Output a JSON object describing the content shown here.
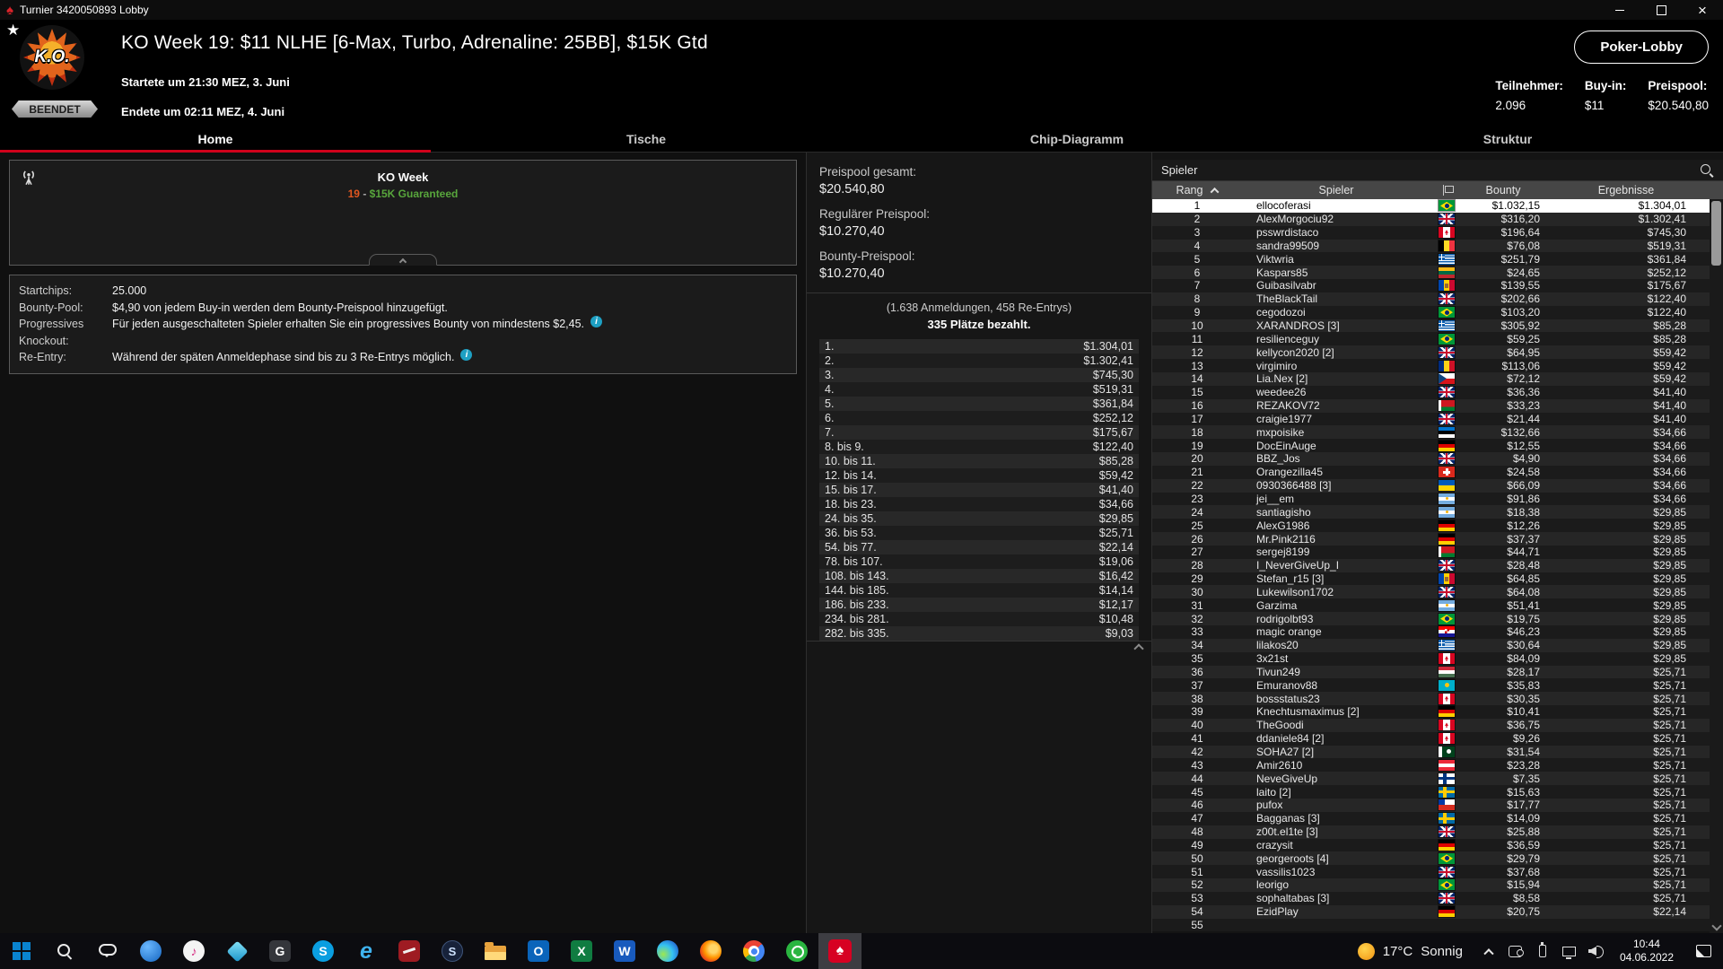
{
  "colors": {
    "accent": "#d0021b",
    "green": "#58a63c",
    "orange": "#e0561f",
    "info": "#1ea0c3",
    "selected_row": "#ffffff"
  },
  "window": {
    "title": "Turnier 3420050893 Lobby"
  },
  "header": {
    "badge": "BEENDET",
    "logo_text": "K.O.",
    "title": "KO Week 19: $11 NLHE [6-Max, Turbo, Adrenaline: 25BB], $15K Gtd",
    "started": "Startete um 21:30 MEZ, 3. Juni",
    "ended": "Endete um 02:11 MEZ, 4. Juni",
    "lobby_button": "Poker-Lobby",
    "stats": [
      {
        "label": "Teilnehmer:",
        "value": "2.096"
      },
      {
        "label": "Buy-in:",
        "value": "$11"
      },
      {
        "label": "Preispool:",
        "value": "$20.540,80"
      }
    ]
  },
  "tabs": [
    {
      "label": "Home",
      "active": true
    },
    {
      "label": "Tische",
      "active": false
    },
    {
      "label": "Chip-Diagramm",
      "active": false
    },
    {
      "label": "Struktur",
      "active": false
    }
  ],
  "broadcast": {
    "title": "KO Week",
    "num": "19",
    "sep": " - ",
    "guarantee": "$15K Guaranteed"
  },
  "details": {
    "rows": [
      {
        "label": "Startchips:",
        "text": "25.000",
        "info": false
      },
      {
        "label": "Bounty-Pool:",
        "text": "$4,90 von jedem Buy-in werden dem Bounty-Preispool hinzugefügt.",
        "info": false
      },
      {
        "label": "Progressives Knockout:",
        "text": "Für jeden ausgeschalteten Spieler erhalten Sie ein progressives Bounty von mindestens $2,45.",
        "info": true
      },
      {
        "label": "Re-Entry:",
        "text": "Während der späten Anmeldephase sind bis zu 3 Re-Entrys möglich.",
        "info": true
      }
    ]
  },
  "prizepool": {
    "total_label": "Preispool gesamt:",
    "total_value": "$20.540,80",
    "regular_label": "Regulärer Preispool:",
    "regular_value": "$10.270,40",
    "bounty_label": "Bounty-Preispool:",
    "bounty_value": "$10.270,40",
    "entries_line": "(1.638 Anmeldungen, 458 Re-Entrys)",
    "paid_line": "335 Plätze bezahlt."
  },
  "payouts": [
    {
      "place": "1.",
      "amount": "$1.304,01"
    },
    {
      "place": "2.",
      "amount": "$1.302,41"
    },
    {
      "place": "3.",
      "amount": "$745,30"
    },
    {
      "place": "4.",
      "amount": "$519,31"
    },
    {
      "place": "5.",
      "amount": "$361,84"
    },
    {
      "place": "6.",
      "amount": "$252,12"
    },
    {
      "place": "7.",
      "amount": "$175,67"
    },
    {
      "place": "8. bis 9.",
      "amount": "$122,40"
    },
    {
      "place": "10. bis 11.",
      "amount": "$85,28"
    },
    {
      "place": "12. bis 14.",
      "amount": "$59,42"
    },
    {
      "place": "15. bis 17.",
      "amount": "$41,40"
    },
    {
      "place": "18. bis 23.",
      "amount": "$34,66"
    },
    {
      "place": "24. bis 35.",
      "amount": "$29,85"
    },
    {
      "place": "36. bis 53.",
      "amount": "$25,71"
    },
    {
      "place": "54. bis 77.",
      "amount": "$22,14"
    },
    {
      "place": "78. bis 107.",
      "amount": "$19,06"
    },
    {
      "place": "108. bis 143.",
      "amount": "$16,42"
    },
    {
      "place": "144. bis 185.",
      "amount": "$14,14"
    },
    {
      "place": "186. bis 233.",
      "amount": "$12,17"
    },
    {
      "place": "234. bis 281.",
      "amount": "$10,48"
    },
    {
      "place": "282. bis 335.",
      "amount": "$9,03"
    }
  ],
  "players": {
    "panel_title": "Spieler",
    "columns": {
      "rank": "Rang",
      "name": "Spieler",
      "bounty": "Bounty",
      "result": "Ergebnisse"
    },
    "rows": [
      {
        "rank": "1",
        "name": "ellocoferasi",
        "flag": "br",
        "bounty": "$1.032,15",
        "result": "$1.304,01",
        "selected": true
      },
      {
        "rank": "2",
        "name": "AlexMorgociu92",
        "flag": "gb",
        "bounty": "$316,20",
        "result": "$1.302,41"
      },
      {
        "rank": "3",
        "name": "psswrdistaco",
        "flag": "ca",
        "bounty": "$196,64",
        "result": "$745,30"
      },
      {
        "rank": "4",
        "name": "sandra99509",
        "flag": "be",
        "bounty": "$76,08",
        "result": "$519,31"
      },
      {
        "rank": "5",
        "name": "Viktwria",
        "flag": "gr",
        "bounty": "$251,79",
        "result": "$361,84"
      },
      {
        "rank": "6",
        "name": "Kaspars85",
        "flag": "lt",
        "bounty": "$24,65",
        "result": "$252,12"
      },
      {
        "rank": "7",
        "name": "Guibasilvabr",
        "flag": "md",
        "bounty": "$139,55",
        "result": "$175,67"
      },
      {
        "rank": "8",
        "name": "TheBlackTail",
        "flag": "gb",
        "bounty": "$202,66",
        "result": "$122,40"
      },
      {
        "rank": "9",
        "name": "cegodozoi",
        "flag": "br",
        "bounty": "$103,20",
        "result": "$122,40"
      },
      {
        "rank": "10",
        "name": "XARANDROS [3]",
        "flag": "gr",
        "bounty": "$305,92",
        "result": "$85,28"
      },
      {
        "rank": "11",
        "name": "resilienceguy",
        "flag": "br",
        "bounty": "$59,25",
        "result": "$85,28"
      },
      {
        "rank": "12",
        "name": "kellycon2020 [2]",
        "flag": "gb",
        "bounty": "$64,95",
        "result": "$59,42"
      },
      {
        "rank": "13",
        "name": "virgimiro",
        "flag": "ro",
        "bounty": "$113,06",
        "result": "$59,42"
      },
      {
        "rank": "14",
        "name": "Lia.Nex [2]",
        "flag": "cz",
        "bounty": "$72,12",
        "result": "$59,42"
      },
      {
        "rank": "15",
        "name": "weedee26",
        "flag": "gb",
        "bounty": "$36,36",
        "result": "$41,40"
      },
      {
        "rank": "16",
        "name": "REZAKOV72",
        "flag": "by",
        "bounty": "$33,23",
        "result": "$41,40"
      },
      {
        "rank": "17",
        "name": "craigie1977",
        "flag": "gb",
        "bounty": "$21,44",
        "result": "$41,40"
      },
      {
        "rank": "18",
        "name": "mxpoisike",
        "flag": "ee",
        "bounty": "$132,66",
        "result": "$34,66"
      },
      {
        "rank": "19",
        "name": "DocEinAuge",
        "flag": "de",
        "bounty": "$12,55",
        "result": "$34,66"
      },
      {
        "rank": "20",
        "name": "BBZ_Jos",
        "flag": "gb",
        "bounty": "$4,90",
        "result": "$34,66"
      },
      {
        "rank": "21",
        "name": "Orangezilla45",
        "flag": "ch",
        "bounty": "$24,58",
        "result": "$34,66"
      },
      {
        "rank": "22",
        "name": "0930366488 [3]",
        "flag": "ua",
        "bounty": "$66,09",
        "result": "$34,66"
      },
      {
        "rank": "23",
        "name": "jei__em",
        "flag": "ar",
        "bounty": "$91,86",
        "result": "$34,66"
      },
      {
        "rank": "24",
        "name": "santiagisho",
        "flag": "ar",
        "bounty": "$18,38",
        "result": "$29,85"
      },
      {
        "rank": "25",
        "name": "AlexG1986",
        "flag": "de",
        "bounty": "$12,26",
        "result": "$29,85"
      },
      {
        "rank": "26",
        "name": "Mr.Pink2116",
        "flag": "de",
        "bounty": "$37,37",
        "result": "$29,85"
      },
      {
        "rank": "27",
        "name": "sergej8199",
        "flag": "by",
        "bounty": "$44,71",
        "result": "$29,85"
      },
      {
        "rank": "28",
        "name": "I_NeverGiveUp_I",
        "flag": "gb",
        "bounty": "$28,48",
        "result": "$29,85"
      },
      {
        "rank": "29",
        "name": "Stefan_r15 [3]",
        "flag": "md",
        "bounty": "$64,85",
        "result": "$29,85"
      },
      {
        "rank": "30",
        "name": "Lukewilson1702",
        "flag": "gb",
        "bounty": "$64,08",
        "result": "$29,85"
      },
      {
        "rank": "31",
        "name": "Garzima",
        "flag": "ar",
        "bounty": "$51,41",
        "result": "$29,85"
      },
      {
        "rank": "32",
        "name": "rodrigolbt93",
        "flag": "br",
        "bounty": "$19,75",
        "result": "$29,85"
      },
      {
        "rank": "33",
        "name": "magic orange",
        "flag": "hr",
        "bounty": "$46,23",
        "result": "$29,85"
      },
      {
        "rank": "34",
        "name": "lilakos20",
        "flag": "gr",
        "bounty": "$30,64",
        "result": "$29,85"
      },
      {
        "rank": "35",
        "name": "3x21st",
        "flag": "ca",
        "bounty": "$84,09",
        "result": "$29,85"
      },
      {
        "rank": "36",
        "name": "Tivun249",
        "flag": "hu",
        "bounty": "$28,17",
        "result": "$25,71"
      },
      {
        "rank": "37",
        "name": "Emuranov88",
        "flag": "kz",
        "bounty": "$35,83",
        "result": "$25,71"
      },
      {
        "rank": "38",
        "name": "bossstatus23",
        "flag": "ca",
        "bounty": "$30,35",
        "result": "$25,71"
      },
      {
        "rank": "39",
        "name": "Knechtusmaximus [2]",
        "flag": "de",
        "bounty": "$10,41",
        "result": "$25,71"
      },
      {
        "rank": "40",
        "name": "TheGoodi",
        "flag": "ca",
        "bounty": "$36,75",
        "result": "$25,71"
      },
      {
        "rank": "41",
        "name": "ddaniele84 [2]",
        "flag": "ca",
        "bounty": "$9,26",
        "result": "$25,71"
      },
      {
        "rank": "42",
        "name": "SOHA27 [2]",
        "flag": "pk",
        "bounty": "$31,54",
        "result": "$25,71"
      },
      {
        "rank": "43",
        "name": "Amir2610",
        "flag": "at",
        "bounty": "$23,28",
        "result": "$25,71"
      },
      {
        "rank": "44",
        "name": "NeveGiveUp",
        "flag": "fi",
        "bounty": "$7,35",
        "result": "$25,71"
      },
      {
        "rank": "45",
        "name": "laito [2]",
        "flag": "se",
        "bounty": "$15,63",
        "result": "$25,71"
      },
      {
        "rank": "46",
        "name": "pufox",
        "flag": "cl",
        "bounty": "$17,77",
        "result": "$25,71"
      },
      {
        "rank": "47",
        "name": "Bagganas [3]",
        "flag": "se",
        "bounty": "$14,09",
        "result": "$25,71"
      },
      {
        "rank": "48",
        "name": "z00t.el1te [3]",
        "flag": "gb",
        "bounty": "$25,88",
        "result": "$25,71"
      },
      {
        "rank": "49",
        "name": "crazysit",
        "flag": "de",
        "bounty": "$36,59",
        "result": "$25,71"
      },
      {
        "rank": "50",
        "name": "georgeroots [4]",
        "flag": "br",
        "bounty": "$29,79",
        "result": "$25,71"
      },
      {
        "rank": "51",
        "name": "vassilis1023",
        "flag": "gb",
        "bounty": "$37,68",
        "result": "$25,71"
      },
      {
        "rank": "52",
        "name": "leorigo",
        "flag": "br",
        "bounty": "$15,94",
        "result": "$25,71"
      },
      {
        "rank": "53",
        "name": "sophaltabas [3]",
        "flag": "gb",
        "bounty": "$8,58",
        "result": "$25,71"
      },
      {
        "rank": "54",
        "name": "EzidPlay",
        "flag": "de",
        "bounty": "$20,75",
        "result": "$22,14"
      },
      {
        "rank": "55",
        "name": "",
        "flag": "",
        "bounty": "",
        "result": ""
      }
    ]
  },
  "taskbar": {
    "items": [
      {
        "name": "start"
      },
      {
        "name": "search"
      },
      {
        "name": "people"
      },
      {
        "name": "app-blue"
      },
      {
        "name": "itunes"
      },
      {
        "name": "gem"
      },
      {
        "name": "g-app"
      },
      {
        "name": "skype"
      },
      {
        "name": "internet-explorer"
      },
      {
        "name": "app-red"
      },
      {
        "name": "steam"
      },
      {
        "name": "file-explorer"
      },
      {
        "name": "outlook"
      },
      {
        "name": "excel"
      },
      {
        "name": "word"
      },
      {
        "name": "edge"
      },
      {
        "name": "firefox"
      },
      {
        "name": "chrome"
      },
      {
        "name": "whatsapp"
      },
      {
        "name": "pokerstars",
        "active": true
      }
    ]
  },
  "tray": {
    "weather_temp": "17°C",
    "weather_cond": "Sonnig",
    "icons": [
      {
        "name": "chevron"
      },
      {
        "name": "teams"
      },
      {
        "name": "usb"
      },
      {
        "name": "network"
      },
      {
        "name": "volume"
      }
    ],
    "time": "10:44",
    "date": "04.06.2022"
  }
}
